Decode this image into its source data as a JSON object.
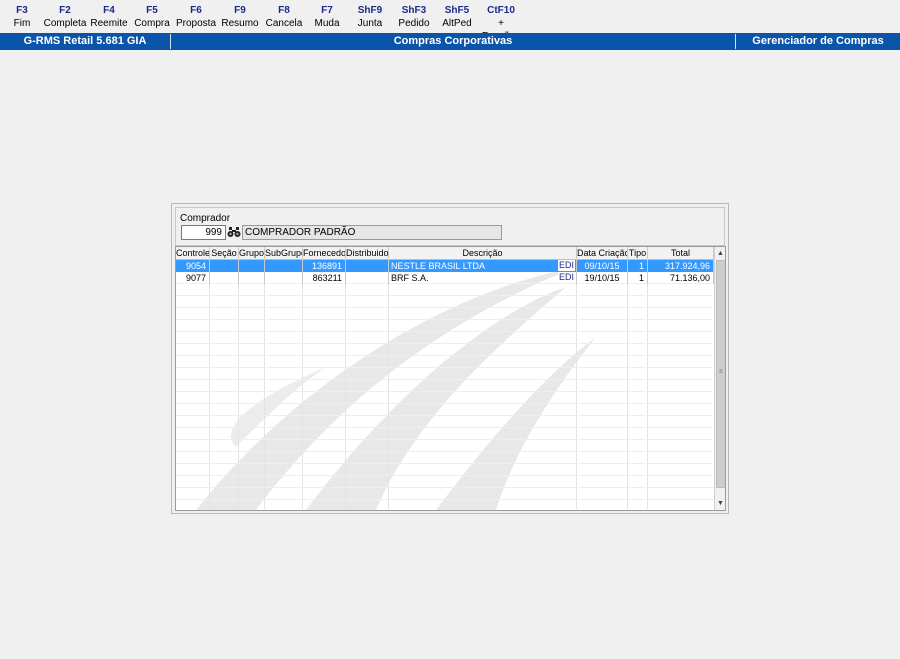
{
  "toolbar": {
    "items": [
      {
        "key": "F3",
        "label": "Fim"
      },
      {
        "key": "F2",
        "label": "Completa"
      },
      {
        "key": "F4",
        "label": "Reemite"
      },
      {
        "key": "F5",
        "label": "Compra"
      },
      {
        "key": "F6",
        "label": "Proposta"
      },
      {
        "key": "F9",
        "label": "Resumo"
      },
      {
        "key": "F8",
        "label": "Cancela"
      },
      {
        "key": "F7",
        "label": "Muda"
      },
      {
        "key": "ShF9",
        "label": "Junta"
      },
      {
        "key": "ShF3",
        "label": "Pedido"
      },
      {
        "key": "ShF5",
        "label": "AltPed"
      },
      {
        "key": "CtF10",
        "label": "+ Funções"
      }
    ]
  },
  "titlebar": {
    "app": "G-RMS Retail 5.681 GIA",
    "module": "Compras Corporativas",
    "screen": "Gerenciador de Compras"
  },
  "filter": {
    "label": "Comprador",
    "code": "999",
    "name": "COMPRADOR PADRÃO"
  },
  "grid": {
    "columns": [
      "Controle",
      "Seção",
      "Grupo",
      "SubGrupo",
      "Fornecedor",
      "Distribuidor",
      "Descrição",
      "Data Criação",
      "Tipo",
      "Total"
    ],
    "rows": [
      {
        "controle": "9054",
        "secao": "",
        "grupo": "",
        "subgrupo": "",
        "fornecedor": "136891",
        "distribuidor": "",
        "descricao": "NESTLE BRASIL LTDA",
        "edi": "EDI",
        "data": "09/10/15",
        "tipo": "1",
        "total": "317.924,96",
        "selected": true
      },
      {
        "controle": "9077",
        "secao": "",
        "grupo": "",
        "subgrupo": "",
        "fornecedor": "863211",
        "distribuidor": "",
        "descricao": "BRF S.A.",
        "edi": "EDI",
        "data": "19/10/15",
        "tipo": "1",
        "total": "71.136,00",
        "selected": false
      }
    ]
  },
  "colors": {
    "titlebar_bg": "#0a55a9",
    "selection_bg": "#3399ff",
    "fkey_color": "#1a2a8a"
  }
}
